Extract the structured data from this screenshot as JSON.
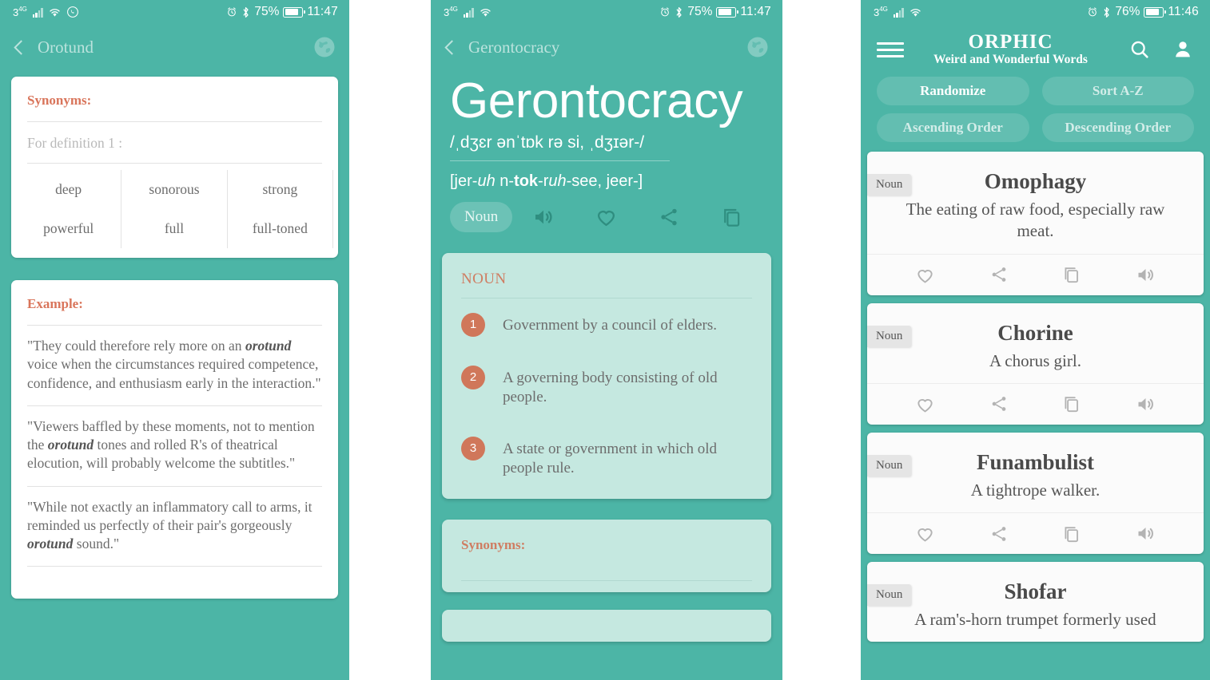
{
  "panel1": {
    "status": {
      "network": "3",
      "network_sup": "4G",
      "battery": "75%",
      "time": "11:47"
    },
    "header": {
      "back_title": "Orotund",
      "globe_icon": "globe-icon"
    },
    "synonyms_card": {
      "title": "Synonyms:",
      "for_definition": "For definition 1 :",
      "words": [
        "deep",
        "sonorous",
        "strong",
        "powerful",
        "full",
        "full-toned"
      ]
    },
    "example_card": {
      "title": "Example:",
      "examples": [
        {
          "pre": "\"They could therefore rely more on an ",
          "em": "orotund",
          "post": " voice when the circumstances required competence, confidence, and enthusiasm early in the interaction.\""
        },
        {
          "pre": "\"Viewers baffled by these moments, not to mention the ",
          "em": "orotund",
          "post": " tones and rolled R's of theatrical elocution, will probably welcome the subtitles.\""
        },
        {
          "pre": "\"While not exactly an inflammatory call to arms, it reminded us perfectly of their pair's gorgeously ",
          "em": "orotund",
          "post": " sound.\""
        }
      ]
    }
  },
  "panel2": {
    "status": {
      "network": "3",
      "network_sup": "4G",
      "battery": "75%",
      "time": "11:47"
    },
    "header": {
      "back_title": "Gerontocracy",
      "globe_icon": "globe-icon"
    },
    "word": "Gerontocracy",
    "ipa": "/ˌdʒɛr ənˈtɒk rə si, ˌdʒɪər-/",
    "respelling": {
      "a": "[jer-",
      "b": "uh",
      "c": " n-",
      "d": "tok",
      "e": "-r",
      "f": "uh",
      "g": "-see, jeer-]"
    },
    "pos_pill": "Noun",
    "actions": [
      "speaker-icon",
      "heart-icon",
      "share-icon",
      "copy-icon"
    ],
    "noun_card": {
      "title": "NOUN",
      "definitions": [
        {
          "num": "1",
          "text": "Government by a council of elders."
        },
        {
          "num": "2",
          "text": "A governing body consisting of old people."
        },
        {
          "num": "3",
          "text": "A state or government in which old people rule."
        }
      ]
    },
    "synonyms_card": {
      "title": "Synonyms:"
    }
  },
  "panel3": {
    "status": {
      "network": "3",
      "network_sup": "4G",
      "battery": "76%",
      "time": "11:46"
    },
    "appbar": {
      "menu_icon": "hamburger-menu-icon",
      "title": "ORPHIC",
      "subtitle": "Weird and Wonderful Words",
      "search_icon": "search-icon",
      "account_icon": "account-icon"
    },
    "sort_buttons": [
      {
        "label": "Randomize",
        "active": true
      },
      {
        "label": "Sort A-Z",
        "active": false
      },
      {
        "label": "Ascending Order",
        "active": false
      },
      {
        "label": "Descending Order",
        "active": false
      }
    ],
    "cards": [
      {
        "pos": "Noun",
        "word": "Omophagy",
        "definition": "The eating of raw food, especially raw meat."
      },
      {
        "pos": "Noun",
        "word": "Chorine",
        "definition": "A chorus girl."
      },
      {
        "pos": "Noun",
        "word": "Funambulist",
        "definition": "A tightrope walker."
      },
      {
        "pos": "Noun",
        "word": "Shofar",
        "definition": "A ram's-horn trumpet formerly used"
      }
    ],
    "card_actions": [
      "heart-icon",
      "share-icon",
      "copy-icon",
      "speaker-icon"
    ]
  },
  "colors": {
    "teal": "#4cb5a6",
    "mint": "#c5e8e0",
    "accent_orange": "#d9755b",
    "card_white": "#ffffff",
    "text_grey": "#6d6d6d"
  }
}
